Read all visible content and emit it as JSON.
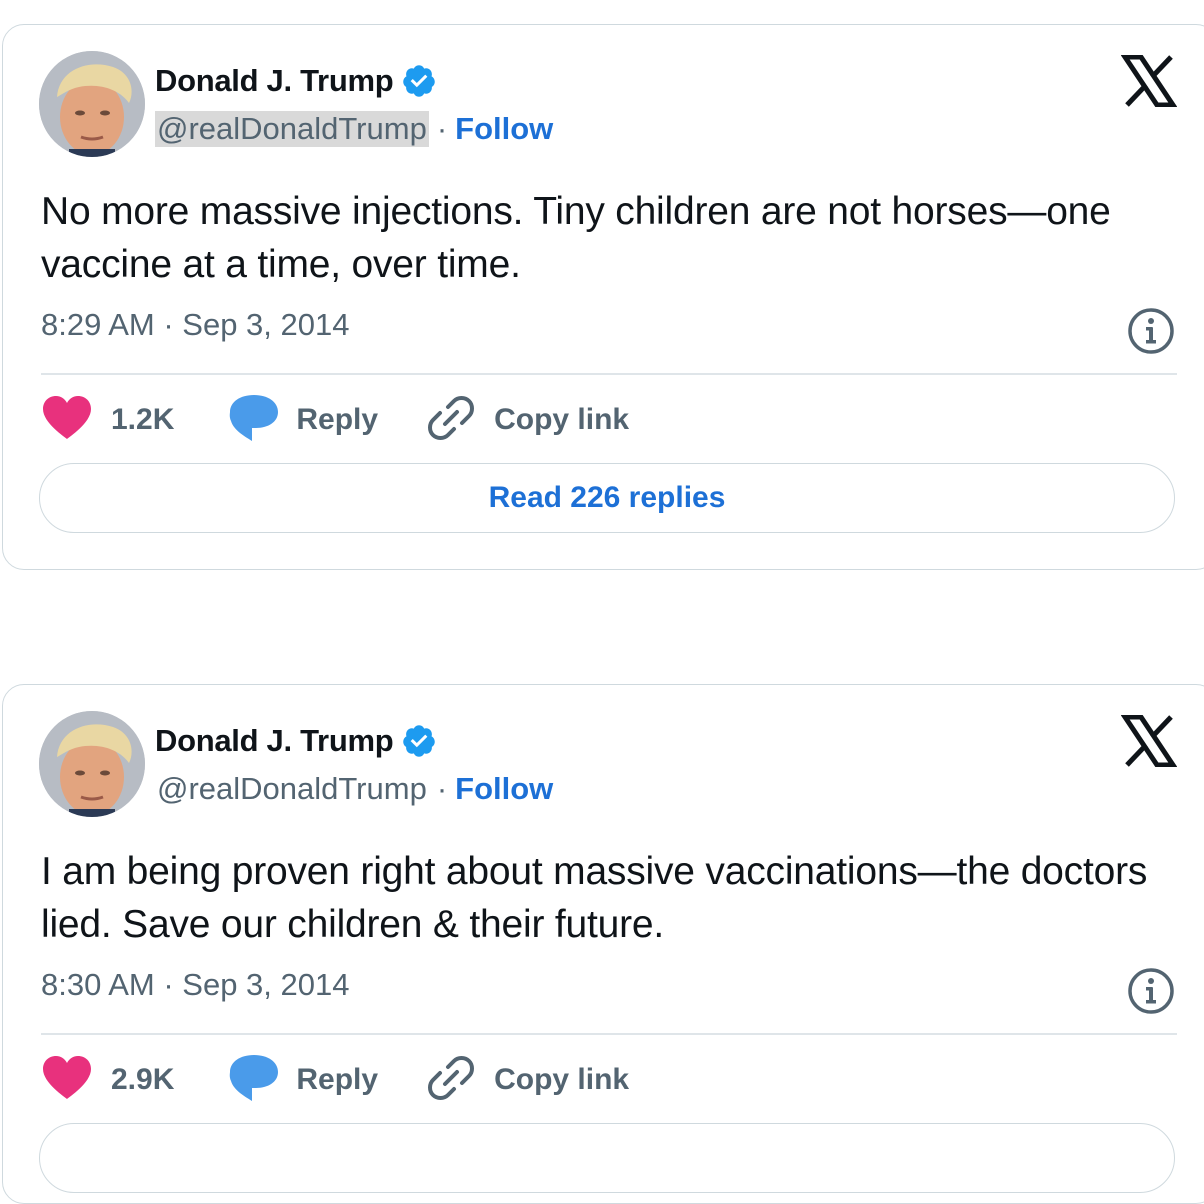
{
  "tweets": [
    {
      "author_name": "Donald J. Trump",
      "handle": "@realDonaldTrump",
      "separator": "·",
      "follow_label": "Follow",
      "text": "No more massive injections. Tiny children are not horses—one vaccine at a time, over time.",
      "timestamp": "8:29 AM · Sep 3, 2014",
      "likes": "1.2K",
      "reply_label": "Reply",
      "copy_link_label": "Copy link",
      "read_replies_label": "Read 226 replies",
      "handle_highlighted": true
    },
    {
      "author_name": "Donald J. Trump",
      "handle": "@realDonaldTrump",
      "separator": "·",
      "follow_label": "Follow",
      "text": "I am being proven right about massive vaccinations—the doctors lied. Save our children & their future.",
      "timestamp": "8:30 AM · Sep 3, 2014",
      "likes": "2.9K",
      "reply_label": "Reply",
      "copy_link_label": "Copy link",
      "read_replies_label": "",
      "handle_highlighted": false
    }
  ],
  "icons": {
    "verified": "verified-badge-icon",
    "platform_logo": "x-logo-icon",
    "info": "info-icon",
    "like": "heart-icon",
    "reply": "speech-bubble-icon",
    "copy_link": "link-icon"
  },
  "colors": {
    "accent_blue": "#1d70d6",
    "verified_blue": "#1d9bf0",
    "like_pink": "#f91880",
    "reply_blue": "#1d9bf0",
    "secondary_text": "#536471",
    "border": "#cfd9de",
    "handle_highlight": "#d9d9d9"
  }
}
